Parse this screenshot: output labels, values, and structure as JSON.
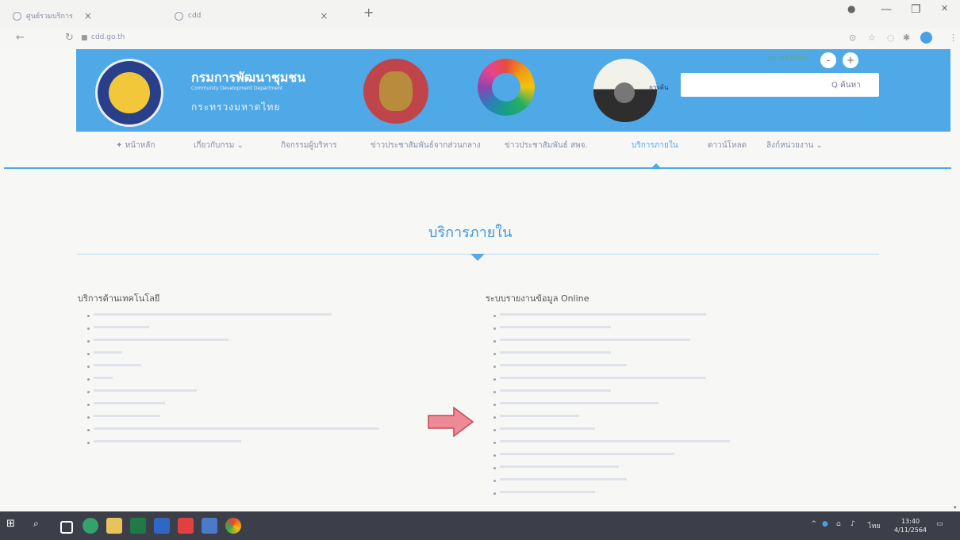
{
  "browser": {
    "tab1_title": "ศูนย์รวมบริการ",
    "tab2_title": "cdd",
    "url": "cdd.go.th",
    "new_tab": "+",
    "minimize": "—",
    "maximize": "❐",
    "close": "✕"
  },
  "header": {
    "site_name": "กรมการพัฒนาชุมชน",
    "subtitle": "Community Development Department",
    "ministry": "กระทรวงมหาดไทย",
    "search_button": "Q ค้นหา",
    "font_plus": "+",
    "font_minus": "-",
    "partial_word": "การค้น"
  },
  "nav": {
    "items": [
      "หน้าหลัก",
      "เกี่ยวกับกรม",
      "กิจกรรมผู้บริหาร",
      "ข่าวประชาสัมพันธ์จากส่วนกลาง",
      "ข่าวประชาสัมพันธ์ สพจ.",
      "บริการภายใน",
      "ดาวน์โหลด",
      "ลิงก์หน่วยงาน"
    ],
    "active": "บริการภายใน"
  },
  "main": {
    "title": "บริการภายใน",
    "left_heading": "บริการด้านเทคโนโลยี",
    "right_heading": "ระบบรายงานข้อมูล Online"
  },
  "taskbar": {
    "clock_time": "13:40",
    "clock_date": "4/11/2564",
    "lang": "ไทย"
  },
  "colors": {
    "banner": "#4fa9e6",
    "accent": "#4ea8ef",
    "taskbar": "#3c3f49"
  }
}
